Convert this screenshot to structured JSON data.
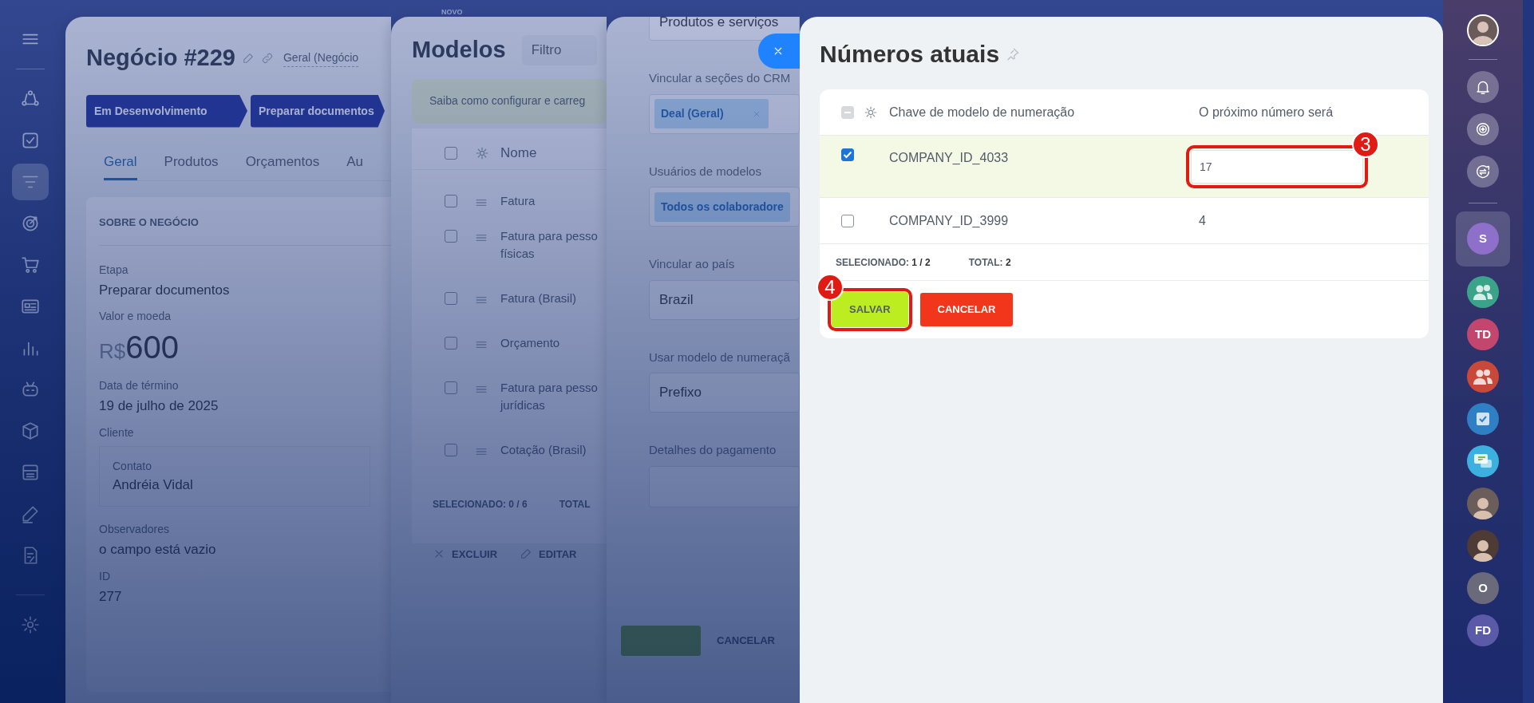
{
  "left_rail": {
    "items": [
      {
        "selected": false
      },
      {
        "selected": false
      },
      {
        "selected": true
      },
      {
        "selected": false
      },
      {
        "selected": false
      },
      {
        "selected": false
      },
      {
        "selected": false
      },
      {
        "selected": false
      },
      {
        "selected": false
      },
      {
        "selected": false
      },
      {
        "selected": false
      },
      {
        "selected": false
      }
    ]
  },
  "top_strip": {
    "label": "NOVO"
  },
  "deal": {
    "title": "Negócio #229",
    "category": "Geral (Negócio",
    "stages": [
      {
        "label": "Em Desenvolvimento"
      },
      {
        "label": "Preparar documentos"
      }
    ],
    "tabs": [
      {
        "label": "Geral",
        "selected": true
      },
      {
        "label": "Produtos",
        "selected": false
      },
      {
        "label": "Orçamentos",
        "selected": false
      },
      {
        "label": "Au",
        "selected": false
      }
    ],
    "section": "SOBRE O NEGÓCIO",
    "fields": [
      {
        "kind": "text",
        "label": "Etapa",
        "value": "Preparar documentos"
      },
      {
        "kind": "money",
        "label": "Valor e moeda",
        "currency": "R$",
        "value": "600"
      },
      {
        "kind": "text",
        "label": "Data de término",
        "value": "19 de julho de 2025"
      },
      {
        "kind": "contact",
        "label": "Cliente",
        "sub_label": "Contato",
        "value": "Andréia Vidal"
      },
      {
        "kind": "text",
        "label": "Observadores",
        "value": "o campo está vazio"
      },
      {
        "kind": "text",
        "label": "ID",
        "value": "277"
      }
    ]
  },
  "templates": {
    "title": "Modelos",
    "filter": {
      "placeholder": "Filtro"
    },
    "hint": "Saiba como configurar e carreg",
    "select_all": {
      "checked": false
    },
    "column": "Nome",
    "rows": [
      {
        "lines": [
          "Fatura"
        ],
        "selected": false
      },
      {
        "lines": [
          "Fatura para pesso",
          "físicas"
        ],
        "selected": false
      },
      {
        "lines": [
          "Fatura (Brasil)"
        ],
        "selected": false
      },
      {
        "lines": [
          "Orçamento"
        ],
        "selected": false
      },
      {
        "lines": [
          "Fatura para pesso",
          "jurídicas"
        ],
        "selected": false
      },
      {
        "lines": [
          "Cotação (Brasil)"
        ],
        "selected": false
      }
    ],
    "selected_label": "SELECIONADO:",
    "selected_count": "0 / 6",
    "total_label": "TOTAL",
    "actions": [
      {
        "kind": "delete",
        "label": "EXCLUIR"
      },
      {
        "kind": "edit",
        "label": "EDITAR"
      }
    ]
  },
  "template_form": {
    "top_value": "Produtos e serviços",
    "fields": [
      {
        "kind": "tags",
        "label": "Vincular a seções do CRM",
        "tags": [
          {
            "label": "Deal (Geral)",
            "removable": true
          }
        ]
      },
      {
        "kind": "tags",
        "label": "Usuários de modelos",
        "tags": [
          {
            "label": "Todos os colaboradore",
            "removable": false
          }
        ]
      },
      {
        "kind": "select",
        "label": "Vincular ao país",
        "value": "Brazil"
      },
      {
        "kind": "select",
        "label": "Usar modelo de numeraçã",
        "value": "Prefixo"
      },
      {
        "kind": "textarea",
        "label": "Detalhes do pagamento"
      }
    ],
    "cancel": "CANCELAR"
  },
  "dialog": {
    "title": "Números atuais",
    "select_all": {
      "checked": false,
      "indeterminate": true
    },
    "columns": [
      "Chave de modelo de numeração",
      "O próximo número será"
    ],
    "rows": [
      {
        "key": "COMPANY_ID_4033",
        "next": "17",
        "selected": true,
        "editing": true,
        "callout": "3"
      },
      {
        "key": "COMPANY_ID_3999",
        "next": "4",
        "selected": false,
        "editing": false
      }
    ],
    "selected_label": "SELECIONADO:",
    "selected_count": "1 / 2",
    "total_label": "TOTAL:",
    "total_count": "2",
    "buttons": [
      {
        "kind": "save",
        "label": "SALVAR",
        "callout": "4"
      },
      {
        "kind": "cancel",
        "label": "CANCELAR"
      }
    ]
  },
  "right_rail": {
    "chats": [
      {
        "kind": "initials",
        "initials": "S",
        "color": "#8e6fc9",
        "selected": true
      },
      {
        "kind": "group",
        "color": "#3aa38a",
        "selected": false
      },
      {
        "kind": "initials",
        "initials": "TD",
        "color": "#c2466e",
        "selected": false
      },
      {
        "kind": "group",
        "color": "#c8493a",
        "selected": false
      },
      {
        "kind": "task",
        "color": "#2f7fc4",
        "selected": false
      },
      {
        "kind": "chat",
        "color": "#3cb1e0",
        "selected": false
      },
      {
        "kind": "person",
        "color": "#6b5d5a",
        "selected": false
      },
      {
        "kind": "person",
        "color": "#4e3b36",
        "selected": false
      },
      {
        "kind": "initials",
        "initials": "O",
        "color": "#6a6a7a",
        "selected": false
      },
      {
        "kind": "initials",
        "initials": "FD",
        "color": "#5a5aa8",
        "selected": false
      }
    ]
  }
}
